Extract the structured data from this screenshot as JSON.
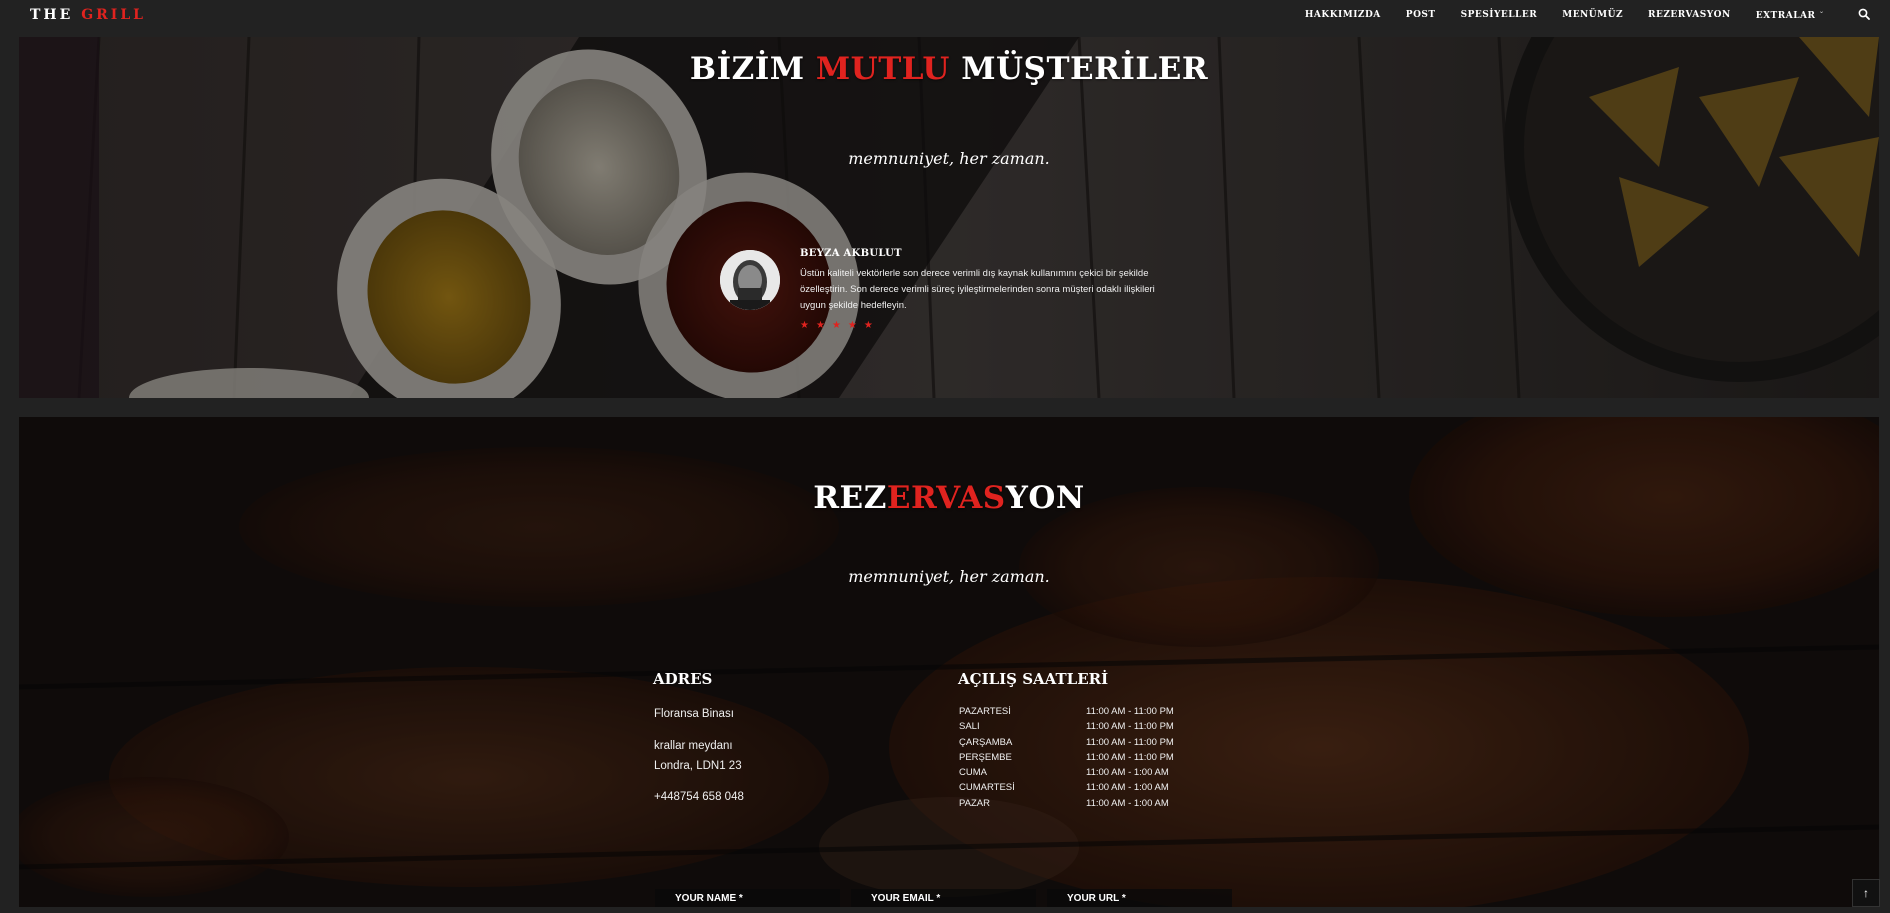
{
  "brand": {
    "logo_part1": "THE",
    "logo_part2": "GRILL",
    "accent": "#e0231f"
  },
  "nav": {
    "items": [
      "HAKKIMIZDA",
      "POST",
      "SPESİYELLER",
      "MENÜMÜZ",
      "REZERVASYON",
      "EXTRALAR"
    ],
    "extras_caret": "ˇ",
    "search_icon": "search-icon"
  },
  "testimonials": {
    "title_part1": "BİZİM",
    "title_part2": "MUTLU",
    "title_part3": "MÜŞTERİLER",
    "tagline": "memnuniyet, her zaman.",
    "reviewer_name": "BEYZA AKBULUT",
    "review_text": "Üstün kaliteli vektörlerle son derece verimli dış kaynak kullanımını çekici bir şekilde özelleştirin. Son derece verimli süreç iyileştirmelerinden sonra müşteri odaklı ilişkileri uygun şekilde hedefleyin.",
    "rating": 5,
    "star_glyph": "★"
  },
  "reservation": {
    "title_part1": "REZ",
    "title_part2": "ERVAS",
    "title_part3": "YON",
    "tagline": "memnuniyet, her zaman.",
    "address": {
      "title": "ADRES",
      "lines": [
        "Floransa Binası",
        "krallar meydanı",
        "Londra, LDN1 23",
        "+448754 658 048"
      ]
    },
    "hours": {
      "title": "AÇILIŞ SAATLERİ",
      "rows": [
        {
          "day": "PAZARTESİ",
          "time": "11:00 AM - 11:00 PM"
        },
        {
          "day": "SALI",
          "time": "11:00 AM - 11:00 PM"
        },
        {
          "day": "ÇARŞAMBA",
          "time": "11:00 AM - 11:00 PM"
        },
        {
          "day": "PERŞEMBE",
          "time": "11:00 AM - 11:00 PM"
        },
        {
          "day": "CUMA",
          "time": "11:00 AM - 1:00 AM"
        },
        {
          "day": "CUMARTESİ",
          "time": "11:00 AM - 1:00 AM"
        },
        {
          "day": "PAZAR",
          "time": "11:00 AM - 1:00 AM"
        }
      ]
    },
    "form": {
      "name_label": "YOUR NAME *",
      "email_label": "YOUR EMAIL *",
      "url_label": "YOUR URL *"
    }
  },
  "back_to_top": "↑"
}
